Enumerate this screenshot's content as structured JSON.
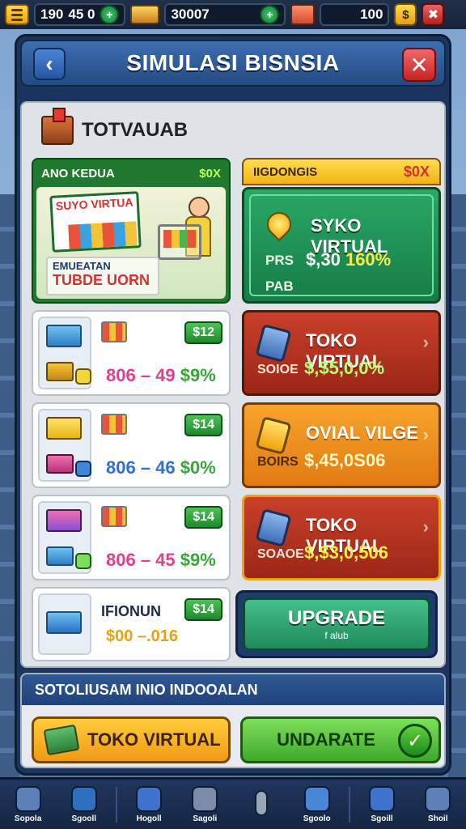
{
  "topbar": {
    "res1_a": "190",
    "res1_b": "45 0",
    "res2": "30007",
    "res3": "100",
    "gold_btn": "$"
  },
  "header": {
    "title": "SIMULASI BISNSIA"
  },
  "section": {
    "title": "TOTVAUAB"
  },
  "featured": {
    "label": "ANO KEDUA",
    "pct": "$0X",
    "banner_line1": "SUYO VIRTUA",
    "banner_line2": "EMUEATAN",
    "banner_line3": "TUBDE UORN"
  },
  "items": [
    {
      "price": "$12",
      "stat_a": "806 – 49",
      "stat_b": "$9%",
      "color": "pink"
    },
    {
      "price": "$14",
      "stat_a": "806 – 46",
      "stat_b": "$0%",
      "color": "blue"
    },
    {
      "price": "$14",
      "stat_a": "806 – 45",
      "stat_b": "$9%",
      "color": "pink"
    },
    {
      "label": "IFIONUN",
      "price": "$14",
      "stat_a": "$00 –.016",
      "color": "yellow"
    }
  ],
  "right_head": {
    "label": "IIGDONGIS",
    "pct": "$0X"
  },
  "right_big": {
    "name": "SYKO VIRTUAL",
    "k1": "PRS",
    "v1_a": "$,30",
    "v1_b": "160%",
    "k2": "PAB"
  },
  "right_cards": [
    {
      "title": "TOKO VIRTUAL",
      "key": "SOIOE",
      "val": "$,$5,0,0%",
      "variant": "red"
    },
    {
      "title": "OVIAL VILGE",
      "key": "BOIRS",
      "val": "$,45,0S06",
      "variant": "orange"
    },
    {
      "title": "TOKO VIRTUAL",
      "key": "SOAOE",
      "val": "$,$3,0,506",
      "variant": "red"
    }
  ],
  "upgrade": {
    "label": "UPGRADE",
    "sub": "f alub"
  },
  "footer": {
    "heading": "SOTOLIUSAM INIO INDOOALAN",
    "btn_toko": "TOKO VIRTUAL",
    "btn_und": "UNDARATE"
  },
  "nav": [
    {
      "label": "Sopola",
      "color": "#5c7fb8"
    },
    {
      "label": "Sgooll",
      "color": "#2f6fc0"
    },
    {
      "label": "Hogoll",
      "color": "#3e73c9"
    },
    {
      "label": "Sagoli",
      "color": "#7b8ca8"
    },
    {
      "label": "",
      "color": "#9aa6b8"
    },
    {
      "label": "Sgoolo",
      "color": "#4a86d6"
    },
    {
      "label": "Sgoill",
      "color": "#3e73c9"
    },
    {
      "label": "Shoil",
      "color": "#5c7fb8"
    }
  ]
}
